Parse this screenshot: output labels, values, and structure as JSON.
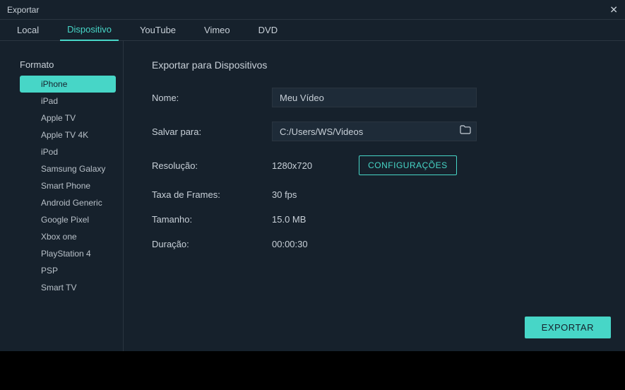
{
  "titlebar": {
    "title": "Exportar"
  },
  "tabs": [
    {
      "label": "Local",
      "active": false
    },
    {
      "label": "Dispositivo",
      "active": true
    },
    {
      "label": "YouTube",
      "active": false
    },
    {
      "label": "Vimeo",
      "active": false
    },
    {
      "label": "DVD",
      "active": false
    }
  ],
  "sidebar": {
    "header": "Formato",
    "items": [
      {
        "label": "iPhone",
        "active": true
      },
      {
        "label": "iPad",
        "active": false
      },
      {
        "label": "Apple TV",
        "active": false
      },
      {
        "label": "Apple TV 4K",
        "active": false
      },
      {
        "label": "iPod",
        "active": false
      },
      {
        "label": "Samsung Galaxy",
        "active": false
      },
      {
        "label": "Smart Phone",
        "active": false
      },
      {
        "label": "Android Generic",
        "active": false
      },
      {
        "label": "Google Pixel",
        "active": false
      },
      {
        "label": "Xbox one",
        "active": false
      },
      {
        "label": "PlayStation 4",
        "active": false
      },
      {
        "label": "PSP",
        "active": false
      },
      {
        "label": "Smart TV",
        "active": false
      }
    ]
  },
  "content": {
    "title": "Exportar para Dispositivos",
    "name_label": "Nome:",
    "name_value": "Meu Vídeo",
    "save_label": "Salvar para:",
    "save_value": "C:/Users/WS/Videos",
    "resolution_label": "Resolução:",
    "resolution_value": "1280x720",
    "settings_btn": "CONFIGURAÇÕES",
    "framerate_label": "Taxa de Frames:",
    "framerate_value": "30 fps",
    "size_label": "Tamanho:",
    "size_value": "15.0 MB",
    "duration_label": "Duração:",
    "duration_value": "00:00:30",
    "export_btn": "EXPORTAR"
  }
}
